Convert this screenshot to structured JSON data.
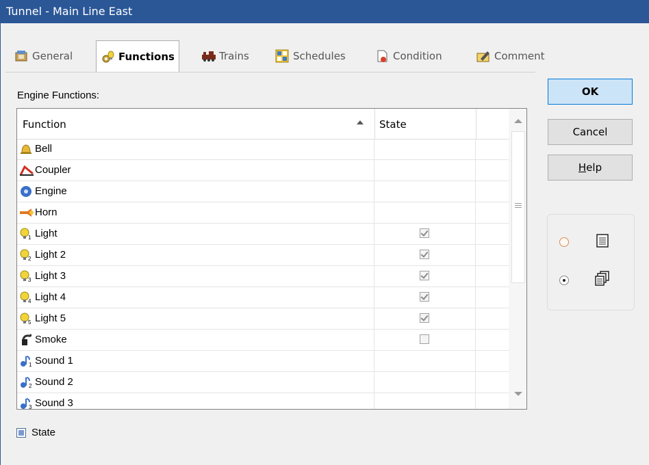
{
  "window": {
    "title": "Tunnel - Main Line East"
  },
  "tabs": [
    {
      "label": "General",
      "icon": "general-icon"
    },
    {
      "label": "Functions",
      "icon": "functions-icon"
    },
    {
      "label": "Trains",
      "icon": "trains-icon"
    },
    {
      "label": "Schedules",
      "icon": "schedules-icon"
    },
    {
      "label": "Condition",
      "icon": "condition-icon"
    },
    {
      "label": "Comment",
      "icon": "comment-icon"
    }
  ],
  "active_tab": "Functions",
  "section_label": "Engine Functions:",
  "grid": {
    "columns": [
      "Function",
      "State"
    ],
    "sorted_column": "Function",
    "rows": [
      {
        "name": "Bell",
        "icon": "bell-icon",
        "state": null
      },
      {
        "name": "Coupler",
        "icon": "coupler-icon",
        "state": null
      },
      {
        "name": "Engine",
        "icon": "engine-icon",
        "state": null
      },
      {
        "name": "Horn",
        "icon": "horn-icon",
        "state": null
      },
      {
        "name": "Light",
        "icon": "light-1-icon",
        "state": true
      },
      {
        "name": "Light 2",
        "icon": "light-2-icon",
        "state": true
      },
      {
        "name": "Light 3",
        "icon": "light-3-icon",
        "state": true
      },
      {
        "name": "Light 4",
        "icon": "light-4-icon",
        "state": true
      },
      {
        "name": "Light 5",
        "icon": "light-5-icon",
        "state": true
      },
      {
        "name": "Smoke",
        "icon": "smoke-icon",
        "state": false
      },
      {
        "name": "Sound 1",
        "icon": "sound-1-icon",
        "state": null
      },
      {
        "name": "Sound 2",
        "icon": "sound-2-icon",
        "state": null
      },
      {
        "name": "Sound 3",
        "icon": "sound-3-icon",
        "state": null
      }
    ]
  },
  "buttons": {
    "ok": "OK",
    "cancel": "Cancel",
    "help_prefix": "H",
    "help_rest": "elp"
  },
  "view_options": [
    {
      "icon": "list-view-icon",
      "selected": false
    },
    {
      "icon": "detail-view-icon",
      "selected": true
    }
  ],
  "legend": {
    "label": "State"
  },
  "colors": {
    "titlebar": "#2b5797",
    "ok_border": "#0078d7",
    "ok_fill": "#cce4f7"
  }
}
